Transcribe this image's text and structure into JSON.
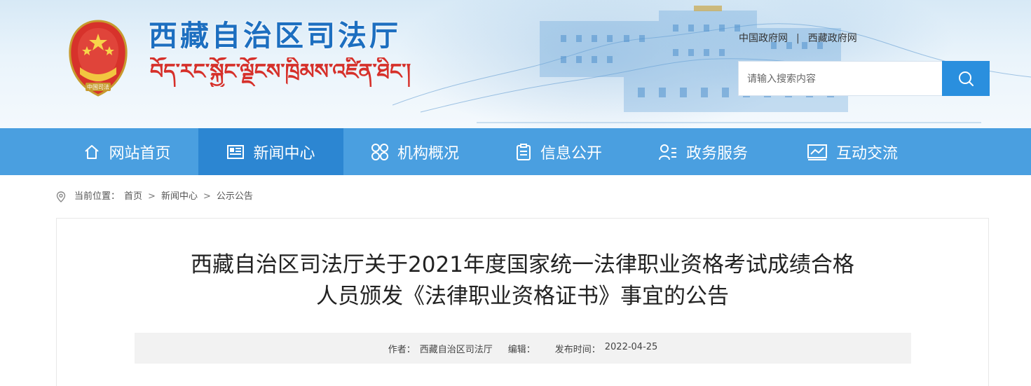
{
  "header": {
    "site_title": "西藏自治区司法厅",
    "tibetan_title": "བོད་རང་སྐྱོང་ལྗོངས་ཁྲིམས་འཛིན་ཐིང་།",
    "emblem_text": "中国司法",
    "top_links": [
      "中国政府网",
      "西藏政府网"
    ],
    "top_links_separator": "|",
    "search": {
      "placeholder": "请输入搜索内容",
      "button_icon": "search-icon"
    }
  },
  "nav": {
    "items": [
      {
        "label": "网站首页",
        "icon": "home-icon",
        "active": false
      },
      {
        "label": "新闻中心",
        "icon": "news-icon",
        "active": true
      },
      {
        "label": "机构概况",
        "icon": "grid-icon",
        "active": false
      },
      {
        "label": "信息公开",
        "icon": "clipboard-icon",
        "active": false
      },
      {
        "label": "政务服务",
        "icon": "user-list-icon",
        "active": false
      },
      {
        "label": "互动交流",
        "icon": "chart-icon",
        "active": false
      }
    ]
  },
  "breadcrumb": {
    "prefix": "当前位置：",
    "items": [
      "首页",
      "新闻中心",
      "公示公告"
    ],
    "separator": ">"
  },
  "article": {
    "title_line1": "西藏自治区司法厅关于2021年度国家统一法律职业资格考试成绩合格",
    "title_line2": "人员颁发《法律职业资格证书》事宜的公告",
    "meta": {
      "author_label": "作者：",
      "author": "西藏自治区司法厅",
      "editor_label": "编辑：",
      "editor": "",
      "date_label": "发布时间：",
      "date": "2022-04-25"
    }
  },
  "colors": {
    "nav_bg": "#4a9fe0",
    "nav_active": "#2c86d2",
    "title_blue": "#1d6fc0",
    "tibetan_red": "#d6302a",
    "search_button": "#2a8fde"
  }
}
